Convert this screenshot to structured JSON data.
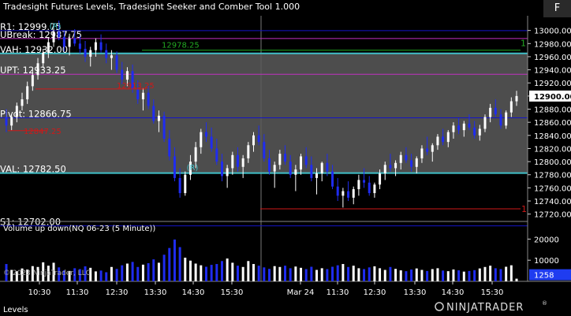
{
  "header": {
    "title": "Tradesight Futures Levels, Tradesight Seeker and Comber Tool 1.000",
    "f_button": "F"
  },
  "footer": {
    "panel_label": "Levels",
    "logo_text": "NINJATRADER",
    "logo_reg": "®"
  },
  "colors": {
    "bar_up": "#ffffff",
    "bar_down": "#1f2cf0",
    "value_area": "#5a5a5a",
    "background": "#000000",
    "level_blue": "#1414c8",
    "level_red": "#d01818",
    "level_green": "#22aa22",
    "level_cyan": "#40c0c8",
    "level_purple": "#c030c0",
    "signal_green": "#1e9e3a"
  },
  "chart_data": {
    "type": "candlestick",
    "instrument": "NQ 06-23 (5 Minute)",
    "ylim": [
      12710,
      13020
    ],
    "y_ticks": [
      13000,
      12980,
      12960,
      12940,
      12920,
      12900,
      12880,
      12860,
      12840,
      12820,
      12800,
      12780,
      12760,
      12740,
      12720
    ],
    "y_tick_labels": [
      "13000.00",
      "12980.00",
      "12960.00",
      "12940.00",
      "12920.00",
      "12900.00",
      "12880.00",
      "12860.00",
      "12840.00",
      "12820.00",
      "12800.00",
      "12780.00",
      "12760.00",
      "12740.00",
      "12720.00"
    ],
    "current_price": 12900,
    "current_price_label": "12900.00",
    "x_labels": [
      "10:30",
      "11:30",
      "12:30",
      "13:30",
      "14:30",
      "15:30",
      "Mar 24",
      "11:30",
      "12:30",
      "13:30",
      "14:30",
      "15:30"
    ],
    "session_break_label": "Mar 24",
    "levels": [
      {
        "label": "R1: 12999.75",
        "value": 12999.75,
        "color": "blue"
      },
      {
        "label": "UBreak: 12987.75",
        "value": 12987.75,
        "color": "purple"
      },
      {
        "label": "VAH: 12932.00",
        "value": 12965,
        "color": "cyan"
      },
      {
        "label": "UPT: 12933.25",
        "value": 12933.25,
        "color": "purple"
      },
      {
        "label": "Pivot: 12866.75",
        "value": 12866.75,
        "color": "blue"
      },
      {
        "label": "VAL: 12782.50",
        "value": 12782.5,
        "color": "cyan"
      },
      {
        "label": "S1: 12702.00",
        "value": 12702,
        "color": "blue"
      }
    ],
    "value_area": [
      12782.5,
      12965
    ],
    "annotations": [
      {
        "text": "12978.25",
        "value": 12978.25,
        "color": "green"
      },
      {
        "text": "12913.25",
        "value": 12913.25,
        "color": "red"
      },
      {
        "text": "12847.25",
        "value": 12847.25,
        "color": "red"
      },
      {
        "text": "1",
        "value": 12980,
        "color": "green"
      },
      {
        "text": "1",
        "value": 12728,
        "color": "red"
      }
    ],
    "markers": [
      {
        "text": "(R)",
        "value": 13010
      },
      {
        "text": "(R)",
        "value": 12787
      }
    ],
    "ohlc": [
      [
        12868,
        12880,
        12845,
        12855
      ],
      [
        12855,
        12872,
        12848,
        12868
      ],
      [
        12868,
        12890,
        12860,
        12885
      ],
      [
        12885,
        12905,
        12878,
        12895
      ],
      [
        12895,
        12922,
        12888,
        12915
      ],
      [
        12915,
        12940,
        12908,
        12932
      ],
      [
        12932,
        12958,
        12925,
        12950
      ],
      [
        12950,
        12972,
        12943,
        12966
      ],
      [
        12966,
        12990,
        12958,
        12982
      ],
      [
        12982,
        13005,
        12975,
        12998
      ],
      [
        12998,
        13015,
        12985,
        12990
      ],
      [
        12990,
        13000,
        12968,
        12975
      ],
      [
        12975,
        12995,
        12962,
        12988
      ],
      [
        12988,
        13002,
        12976,
        12980
      ],
      [
        12980,
        12992,
        12965,
        12972
      ],
      [
        12972,
        12984,
        12952,
        12960
      ],
      [
        12960,
        12975,
        12945,
        12970
      ],
      [
        12970,
        12988,
        12960,
        12982
      ],
      [
        12982,
        12994,
        12966,
        12970
      ],
      [
        12970,
        12980,
        12950,
        12958
      ],
      [
        12958,
        12970,
        12940,
        12962
      ],
      [
        12962,
        12968,
        12935,
        12940
      ],
      [
        12940,
        12952,
        12918,
        12925
      ],
      [
        12925,
        12944,
        12915,
        12938
      ],
      [
        12938,
        12948,
        12905,
        12910
      ],
      [
        12910,
        12924,
        12888,
        12895
      ],
      [
        12895,
        12912,
        12878,
        12905
      ],
      [
        12905,
        12915,
        12880,
        12885
      ],
      [
        12885,
        12895,
        12858,
        12862
      ],
      [
        12862,
        12878,
        12845,
        12870
      ],
      [
        12870,
        12876,
        12830,
        12835
      ],
      [
        12835,
        12848,
        12802,
        12808
      ],
      [
        12808,
        12822,
        12770,
        12775
      ],
      [
        12775,
        12790,
        12745,
        12752
      ],
      [
        12752,
        12785,
        12748,
        12780
      ],
      [
        12780,
        12810,
        12772,
        12800
      ],
      [
        12800,
        12830,
        12790,
        12822
      ],
      [
        12822,
        12850,
        12812,
        12845
      ],
      [
        12845,
        12860,
        12830,
        12838
      ],
      [
        12838,
        12852,
        12815,
        12820
      ],
      [
        12820,
        12835,
        12795,
        12800
      ],
      [
        12800,
        12812,
        12770,
        12778
      ],
      [
        12778,
        12795,
        12760,
        12790
      ],
      [
        12790,
        12815,
        12780,
        12810
      ],
      [
        12810,
        12822,
        12785,
        12792
      ],
      [
        12792,
        12810,
        12775,
        12805
      ],
      [
        12805,
        12830,
        12798,
        12825
      ],
      [
        12825,
        12845,
        12815,
        12840
      ],
      [
        12840,
        12855,
        12825,
        12830
      ],
      [
        12830,
        12842,
        12800,
        12805
      ],
      [
        12805,
        12818,
        12780,
        12785
      ],
      [
        12785,
        12800,
        12760,
        12795
      ],
      [
        12795,
        12818,
        12788,
        12812
      ],
      [
        12812,
        12825,
        12795,
        12800
      ],
      [
        12800,
        12810,
        12775,
        12780
      ],
      [
        12780,
        12795,
        12755,
        12788
      ],
      [
        12788,
        12812,
        12780,
        12808
      ],
      [
        12808,
        12822,
        12790,
        12795
      ],
      [
        12795,
        12808,
        12770,
        12775
      ],
      [
        12775,
        12790,
        12750,
        12782
      ],
      [
        12782,
        12800,
        12770,
        12798
      ],
      [
        12798,
        12812,
        12778,
        12785
      ],
      [
        12785,
        12795,
        12758,
        12762
      ],
      [
        12762,
        12775,
        12740,
        12748
      ],
      [
        12748,
        12760,
        12730,
        12755
      ],
      [
        12755,
        12770,
        12740,
        12745
      ],
      [
        12745,
        12762,
        12735,
        12758
      ],
      [
        12758,
        12780,
        12748,
        12772
      ],
      [
        12772,
        12790,
        12760,
        12768
      ],
      [
        12768,
        12778,
        12748,
        12752
      ],
      [
        12752,
        12768,
        12745,
        12765
      ],
      [
        12765,
        12788,
        12758,
        12782
      ],
      [
        12782,
        12800,
        12772,
        12795
      ],
      [
        12795,
        12812,
        12785,
        12790
      ],
      [
        12790,
        12802,
        12778,
        12798
      ],
      [
        12798,
        12815,
        12788,
        12810
      ],
      [
        12810,
        12822,
        12798,
        12802
      ],
      [
        12802,
        12812,
        12785,
        12792
      ],
      [
        12792,
        12808,
        12782,
        12805
      ],
      [
        12805,
        12825,
        12798,
        12820
      ],
      [
        12820,
        12838,
        12810,
        12815
      ],
      [
        12815,
        12828,
        12800,
        12825
      ],
      [
        12825,
        12842,
        12818,
        12838
      ],
      [
        12838,
        12850,
        12825,
        12830
      ],
      [
        12830,
        12848,
        12822,
        12845
      ],
      [
        12845,
        12860,
        12835,
        12855
      ],
      [
        12855,
        12866,
        12842,
        12848
      ],
      [
        12848,
        12862,
        12838,
        12858
      ],
      [
        12858,
        12872,
        12848,
        12852
      ],
      [
        12852,
        12862,
        12835,
        12840
      ],
      [
        12840,
        12856,
        12832,
        12850
      ],
      [
        12850,
        12872,
        12845,
        12868
      ],
      [
        12868,
        12888,
        12860,
        12882
      ],
      [
        12882,
        12895,
        12868,
        12872
      ],
      [
        12872,
        12880,
        12850,
        12855
      ],
      [
        12855,
        12878,
        12850,
        12875
      ],
      [
        12875,
        12898,
        12868,
        12892
      ],
      [
        12892,
        12908,
        12885,
        12900
      ]
    ],
    "volume_panel": {
      "title": "Volume up down(NQ 06-23 (5 Minute))",
      "ylim": [
        0,
        25000
      ],
      "y_ticks": [
        20000,
        10000
      ],
      "y_tick_labels": [
        "20000",
        "10000"
      ],
      "current_label": "1258",
      "current_value": 1258,
      "values": [
        8200,
        5400,
        4800,
        6100,
        5600,
        7200,
        6800,
        9000,
        7400,
        8800,
        6600,
        5200,
        4900,
        6200,
        5800,
        7100,
        6400,
        4700,
        5100,
        4300,
        6800,
        5900,
        7600,
        8400,
        9200,
        6800,
        7900,
        8600,
        10400,
        8800,
        12600,
        15800,
        19800,
        16200,
        11200,
        9800,
        8400,
        7600,
        6900,
        7800,
        8200,
        9600,
        10800,
        8800,
        7400,
        6800,
        9600,
        8200,
        7400,
        6600,
        5900,
        7200,
        6800,
        7400,
        6200,
        7000,
        6400,
        5800,
        6900,
        5400,
        6200,
        5800,
        6900,
        7600,
        8200,
        6800,
        7400,
        6200,
        5800,
        6600,
        7100,
        6200,
        5400,
        6800,
        5900,
        5200,
        4800,
        5600,
        6100,
        5400,
        4900,
        5800,
        6200,
        5100,
        4800,
        5600,
        5200,
        4600,
        4900,
        5300,
        6100,
        6800,
        7400,
        6200,
        5800,
        6900,
        7600,
        1258
      ]
    }
  }
}
